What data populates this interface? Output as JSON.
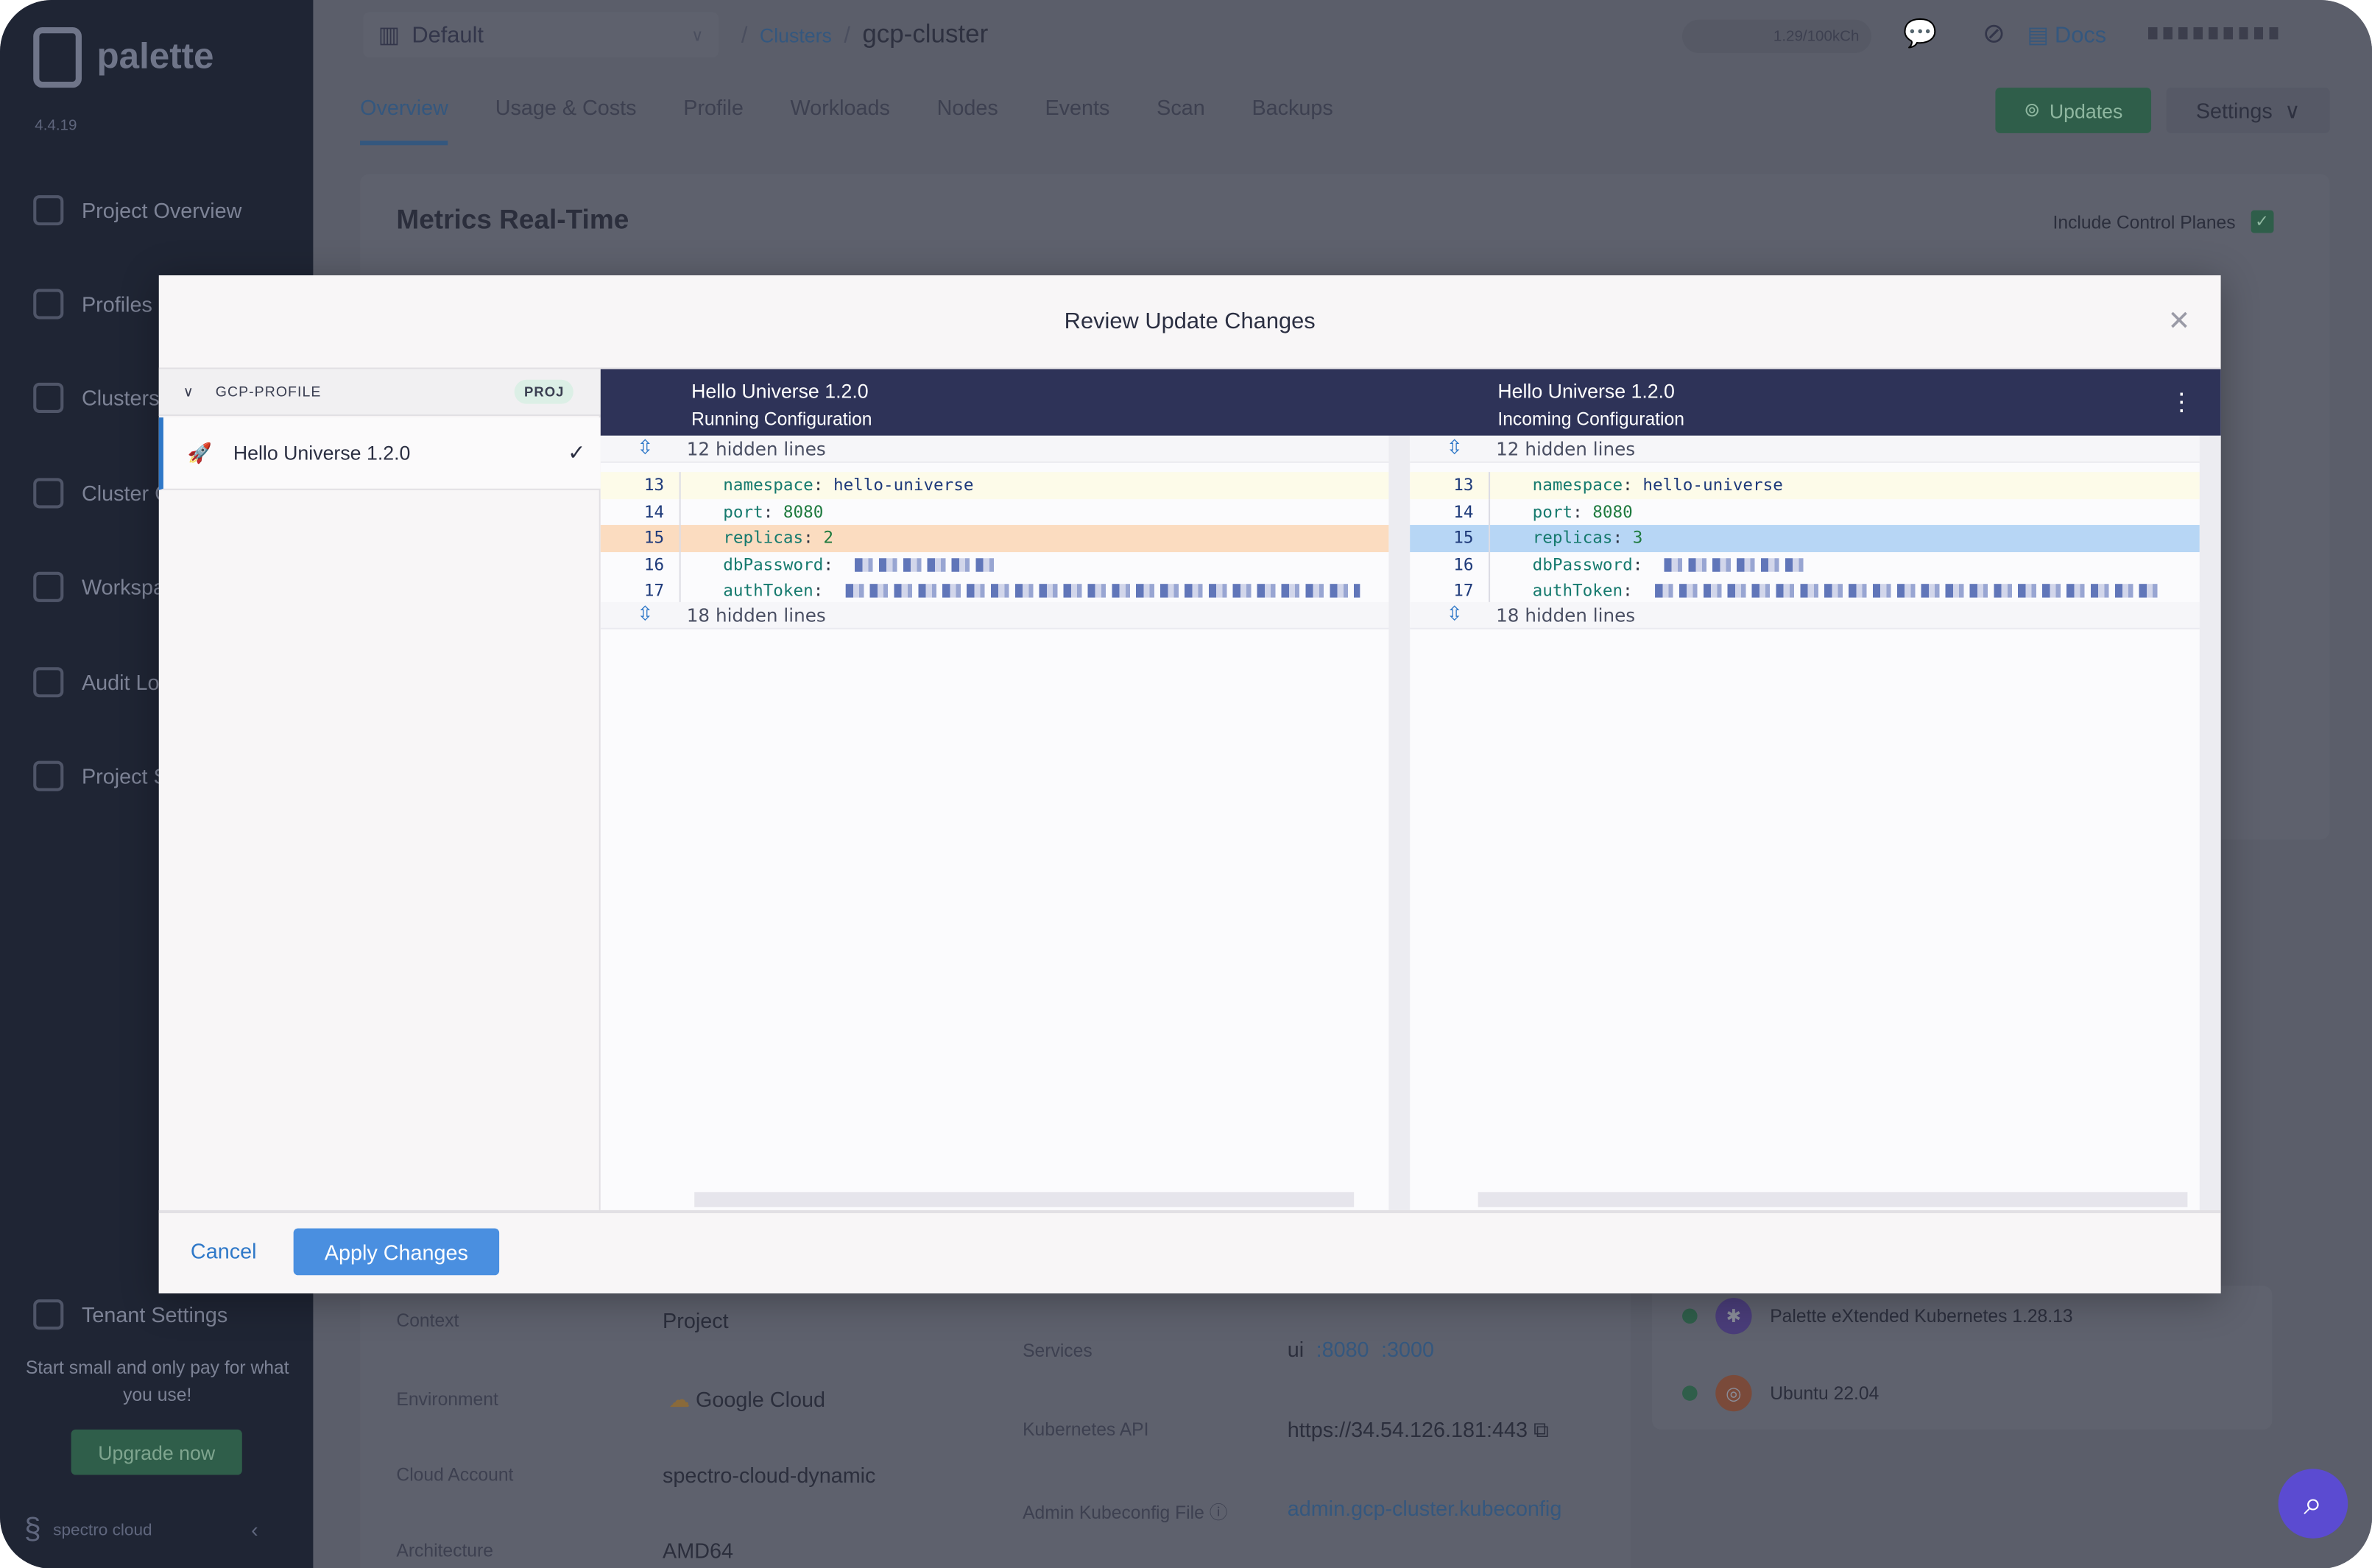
{
  "sidebar": {
    "brand": "palette",
    "version": "4.4.19",
    "items": [
      {
        "label": "Project Overview"
      },
      {
        "label": "Profiles"
      },
      {
        "label": "Clusters"
      },
      {
        "label": "Cluster Groups"
      },
      {
        "label": "Workspaces"
      },
      {
        "label": "Audit Logs"
      },
      {
        "label": "Project Settings"
      }
    ],
    "tenant_settings": "Tenant Settings",
    "promo": "Start small and only pay for what you use!",
    "upgrade": "Upgrade now",
    "footer_brand": "spectro cloud"
  },
  "header": {
    "project": "Default",
    "breadcrumb": {
      "parent": "Clusters",
      "current": "gcp-cluster"
    },
    "usage": "1.29/100kCh",
    "docs": "Docs"
  },
  "tabs": [
    {
      "label": "Overview",
      "active": true
    },
    {
      "label": "Usage & Costs"
    },
    {
      "label": "Profile"
    },
    {
      "label": "Workloads"
    },
    {
      "label": "Nodes"
    },
    {
      "label": "Events"
    },
    {
      "label": "Scan"
    },
    {
      "label": "Backups"
    }
  ],
  "actions": {
    "updates": "Updates",
    "settings": "Settings"
  },
  "metrics": {
    "title": "Metrics Real-Time",
    "include_control_planes": "Include Control Planes",
    "include_control_planes_checked": true
  },
  "details": {
    "context_label": "Context",
    "context": "Project",
    "environment_label": "Environment",
    "environment": "Google Cloud",
    "cloud_account_label": "Cloud Account",
    "cloud_account": "spectro-cloud-dynamic",
    "architecture_label": "Architecture",
    "architecture": "AMD64",
    "services_label": "Services",
    "services": [
      "ui",
      ":8080",
      ":3000"
    ],
    "k8s_api_label": "Kubernetes API",
    "k8s_api": "https://34.54.126.181:443",
    "kubeconfig_label": "Admin Kubeconfig File",
    "kubeconfig": "admin.gcp-cluster.kubeconfig"
  },
  "packs": [
    {
      "name": "Palette eXtended Kubernetes 1.28.13",
      "status_color": "#2f9e63"
    },
    {
      "name": "Ubuntu 22.04",
      "status_color": "#2f9e63"
    }
  ],
  "modal": {
    "title": "Review Update Changes",
    "profile_group": "GCP-PROFILE",
    "group_badge": "PROJ",
    "selected_item": "Hello Universe 1.2.0",
    "left": {
      "title": "Hello Universe 1.2.0",
      "subtitle": "Running Configuration"
    },
    "right": {
      "title": "Hello Universe 1.2.0",
      "subtitle": "Incoming Configuration"
    },
    "hidden_top": "12 hidden lines",
    "hidden_bottom": "18 hidden lines",
    "left_lines": [
      {
        "n": "13",
        "key": "namespace",
        "value": "hello-universe"
      },
      {
        "n": "14",
        "key": "port",
        "value": "8080"
      },
      {
        "n": "15",
        "key": "replicas",
        "value": "2"
      },
      {
        "n": "16",
        "key": "dbPassword",
        "value": ""
      },
      {
        "n": "17",
        "key": "authToken",
        "value": ""
      }
    ],
    "right_lines": [
      {
        "n": "13",
        "key": "namespace",
        "value": "hello-universe"
      },
      {
        "n": "14",
        "key": "port",
        "value": "8080"
      },
      {
        "n": "15",
        "key": "replicas",
        "value": "3"
      },
      {
        "n": "16",
        "key": "dbPassword",
        "value": ""
      },
      {
        "n": "17",
        "key": "authToken",
        "value": ""
      }
    ],
    "colors": {
      "removed": "#fbdcc0",
      "added": "#b7d6f5",
      "header": "#2e3358"
    },
    "cancel": "Cancel",
    "apply": "Apply Changes"
  }
}
